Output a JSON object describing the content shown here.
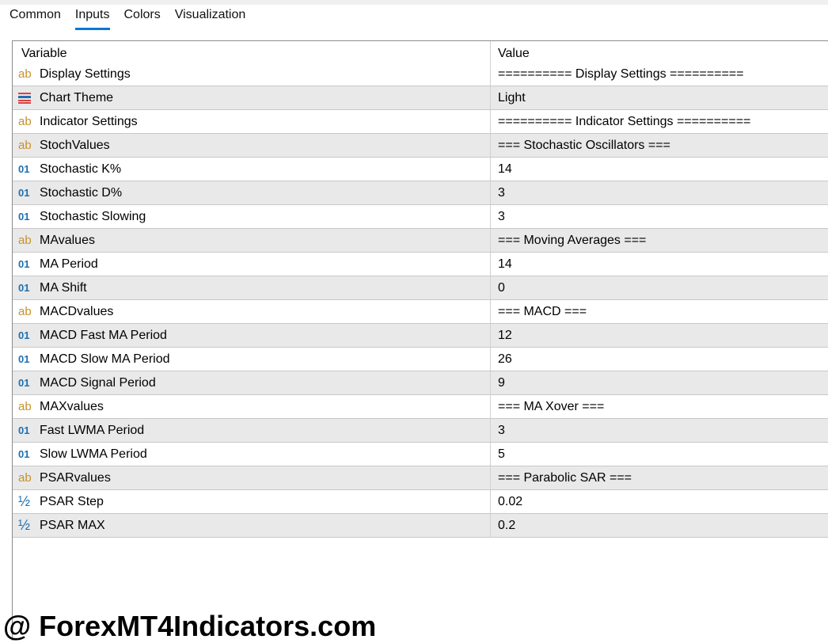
{
  "tabs": [
    "Common",
    "Inputs",
    "Colors",
    "Visualization"
  ],
  "active_tab": "Inputs",
  "columns": {
    "variable": "Variable",
    "value": "Value"
  },
  "rows": [
    {
      "icon": "ab",
      "variable": "Display Settings",
      "value": "========== Display Settings =========="
    },
    {
      "icon": "enum",
      "variable": "Chart Theme",
      "value": "Light"
    },
    {
      "icon": "ab",
      "variable": "Indicator Settings",
      "value": "========== Indicator Settings =========="
    },
    {
      "icon": "ab",
      "variable": "StochValues",
      "value": "=== Stochastic Oscillators ==="
    },
    {
      "icon": "01",
      "variable": "Stochastic K%",
      "value": "14"
    },
    {
      "icon": "01",
      "variable": "Stochastic D%",
      "value": "3"
    },
    {
      "icon": "01",
      "variable": "Stochastic Slowing",
      "value": "3"
    },
    {
      "icon": "ab",
      "variable": "MAvalues",
      "value": "=== Moving Averages ==="
    },
    {
      "icon": "01",
      "variable": "MA Period",
      "value": "14"
    },
    {
      "icon": "01",
      "variable": "MA Shift",
      "value": "0"
    },
    {
      "icon": "ab",
      "variable": "MACDvalues",
      "value": "=== MACD ==="
    },
    {
      "icon": "01",
      "variable": "MACD Fast MA Period",
      "value": "12"
    },
    {
      "icon": "01",
      "variable": "MACD Slow MA Period",
      "value": "26"
    },
    {
      "icon": "01",
      "variable": "MACD Signal Period",
      "value": "9"
    },
    {
      "icon": "ab",
      "variable": "MAXvalues",
      "value": "=== MA Xover ==="
    },
    {
      "icon": "01",
      "variable": "Fast LWMA Period",
      "value": "3"
    },
    {
      "icon": "01",
      "variable": "Slow LWMA Period",
      "value": "5"
    },
    {
      "icon": "ab",
      "variable": "PSARvalues",
      "value": "=== Parabolic SAR ==="
    },
    {
      "icon": "half",
      "variable": "PSAR Step",
      "value": "0.02"
    },
    {
      "icon": "half",
      "variable": "PSAR MAX",
      "value": "0.2"
    }
  ],
  "watermark": "@ ForexMT4Indicators.com"
}
